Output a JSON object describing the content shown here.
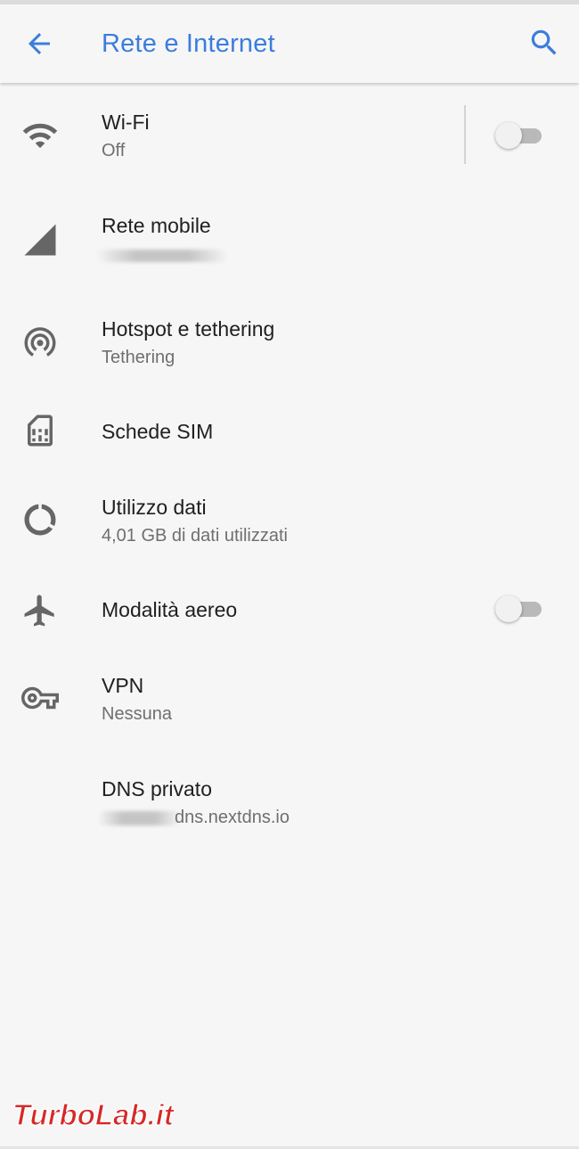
{
  "header": {
    "title": "Rete e Internet",
    "back_icon": "arrow-back-icon",
    "search_icon": "search-icon",
    "accent_color": "#3b7ddd"
  },
  "items": [
    {
      "label": "Wi-Fi",
      "sub": "Off",
      "icon": "wifi-icon",
      "toggle": false
    },
    {
      "label": "Rete mobile",
      "sub": "",
      "icon": "signal-icon"
    },
    {
      "label": "Hotspot e tethering",
      "sub": "Tethering",
      "icon": "hotspot-icon"
    },
    {
      "label": "Schede SIM",
      "sub": "",
      "icon": "sim-card-icon"
    },
    {
      "label": "Utilizzo dati",
      "sub": "4,01 GB di dati utilizzati",
      "icon": "data-usage-icon"
    },
    {
      "label": "Modalità aereo",
      "sub": "",
      "icon": "airplane-icon",
      "toggle": false
    },
    {
      "label": "VPN",
      "sub": "Nessuna",
      "icon": "vpn-key-icon"
    },
    {
      "label": "DNS privato",
      "sub": "dns.nextdns.io"
    }
  ],
  "watermark": {
    "text": "TurboLab.it"
  }
}
